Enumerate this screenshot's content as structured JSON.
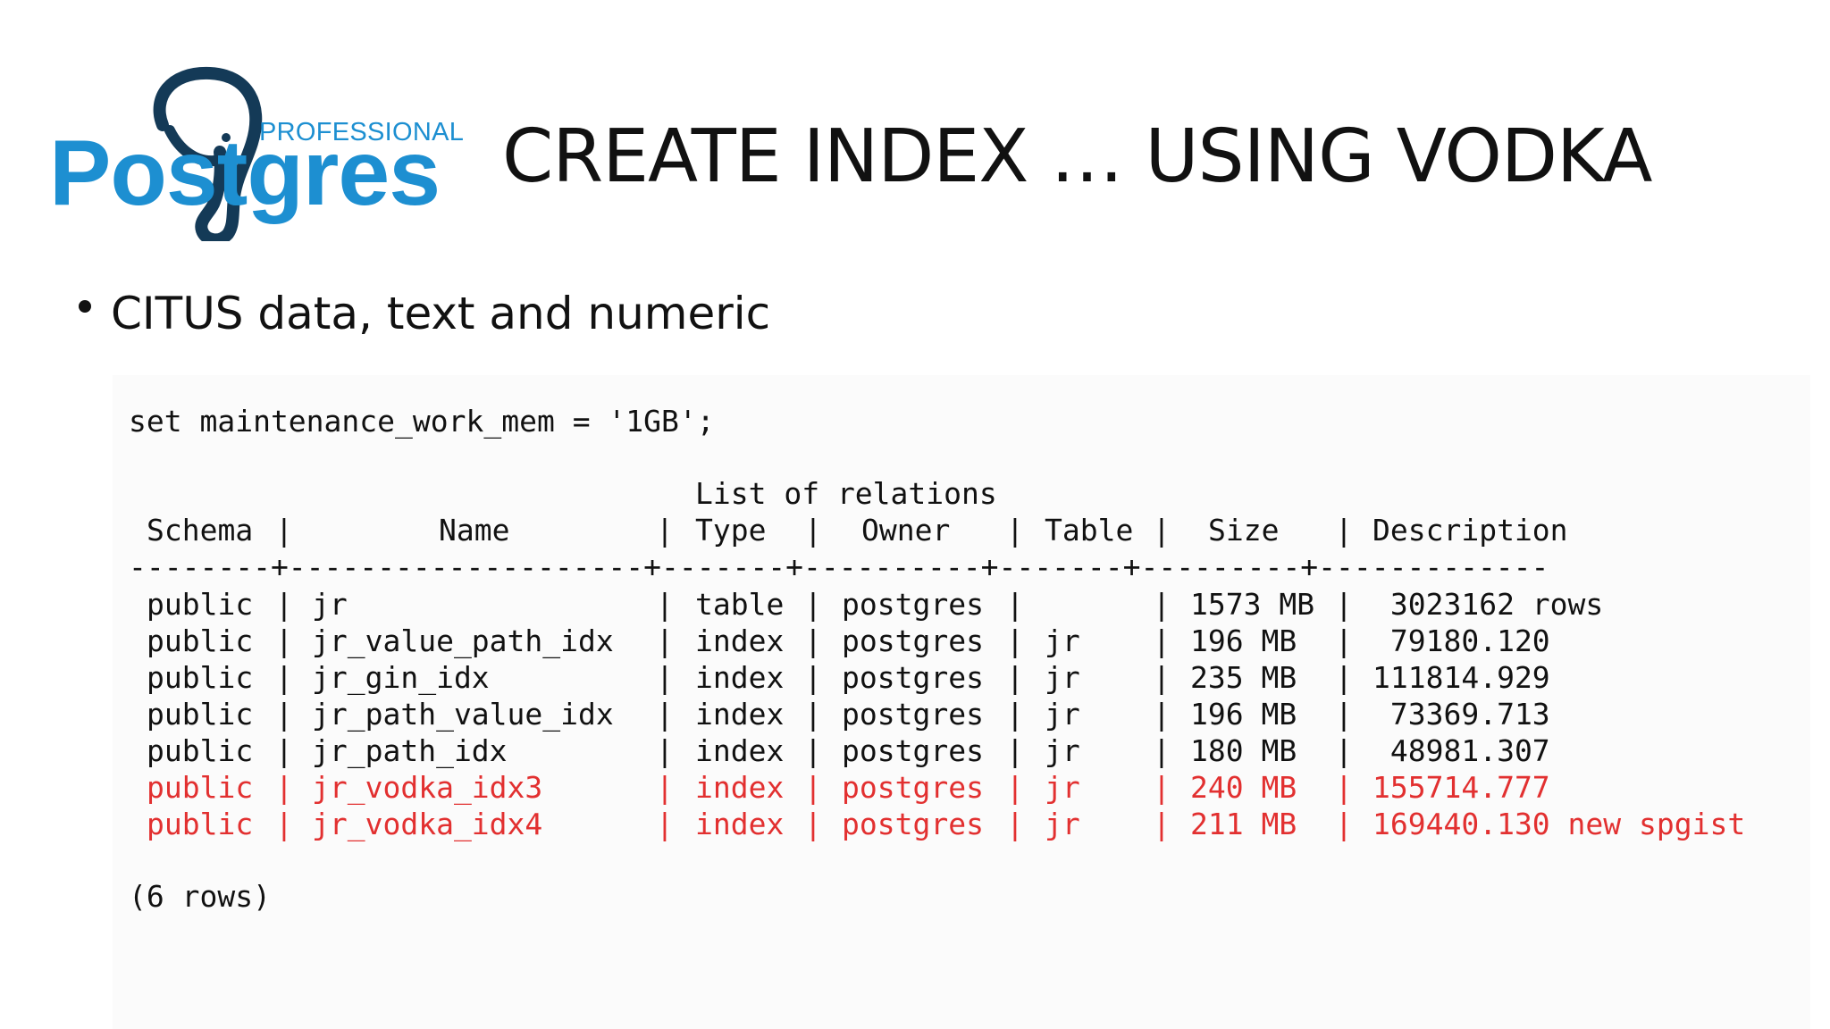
{
  "logo": {
    "professional": "PROFESSIONAL",
    "wordmark": "Postgres"
  },
  "title": "CREATE INDEX … USING VODKA",
  "bullet": "CITUS data, text and numeric",
  "set_command": "set maintenance_work_mem = '1GB';",
  "table": {
    "caption": "List of relations",
    "headers": [
      "Schema",
      "Name",
      "Type",
      "Owner",
      "Table",
      "Size",
      "Description"
    ],
    "rows": [
      {
        "schema": "public",
        "name": "jr",
        "type": "table",
        "owner": "postgres",
        "table": "",
        "size": "1573 MB",
        "description": " 3023162 rows",
        "highlight": false
      },
      {
        "schema": "public",
        "name": "jr_value_path_idx",
        "type": "index",
        "owner": "postgres",
        "table": "jr",
        "size": "196 MB",
        "description": " 79180.120",
        "highlight": false
      },
      {
        "schema": "public",
        "name": "jr_gin_idx",
        "type": "index",
        "owner": "postgres",
        "table": "jr",
        "size": "235 MB",
        "description": "111814.929",
        "highlight": false
      },
      {
        "schema": "public",
        "name": "jr_path_value_idx",
        "type": "index",
        "owner": "postgres",
        "table": "jr",
        "size": "196 MB",
        "description": " 73369.713",
        "highlight": false
      },
      {
        "schema": "public",
        "name": "jr_path_idx",
        "type": "index",
        "owner": "postgres",
        "table": "jr",
        "size": "180 MB",
        "description": " 48981.307",
        "highlight": false
      },
      {
        "schema": "public",
        "name": "jr_vodka_idx3",
        "type": "index",
        "owner": "postgres",
        "table": "jr",
        "size": "240 MB",
        "description": "155714.777",
        "highlight": true
      },
      {
        "schema": "public",
        "name": "jr_vodka_idx4",
        "type": "index",
        "owner": "postgres",
        "table": "jr",
        "size": "211 MB",
        "description": "169440.130 new spgist",
        "highlight": true
      }
    ],
    "footer": "(6 rows)"
  },
  "colors": {
    "highlight": "#e23030",
    "brand_blue": "#1d8fd1",
    "elephant": "#143a57"
  }
}
